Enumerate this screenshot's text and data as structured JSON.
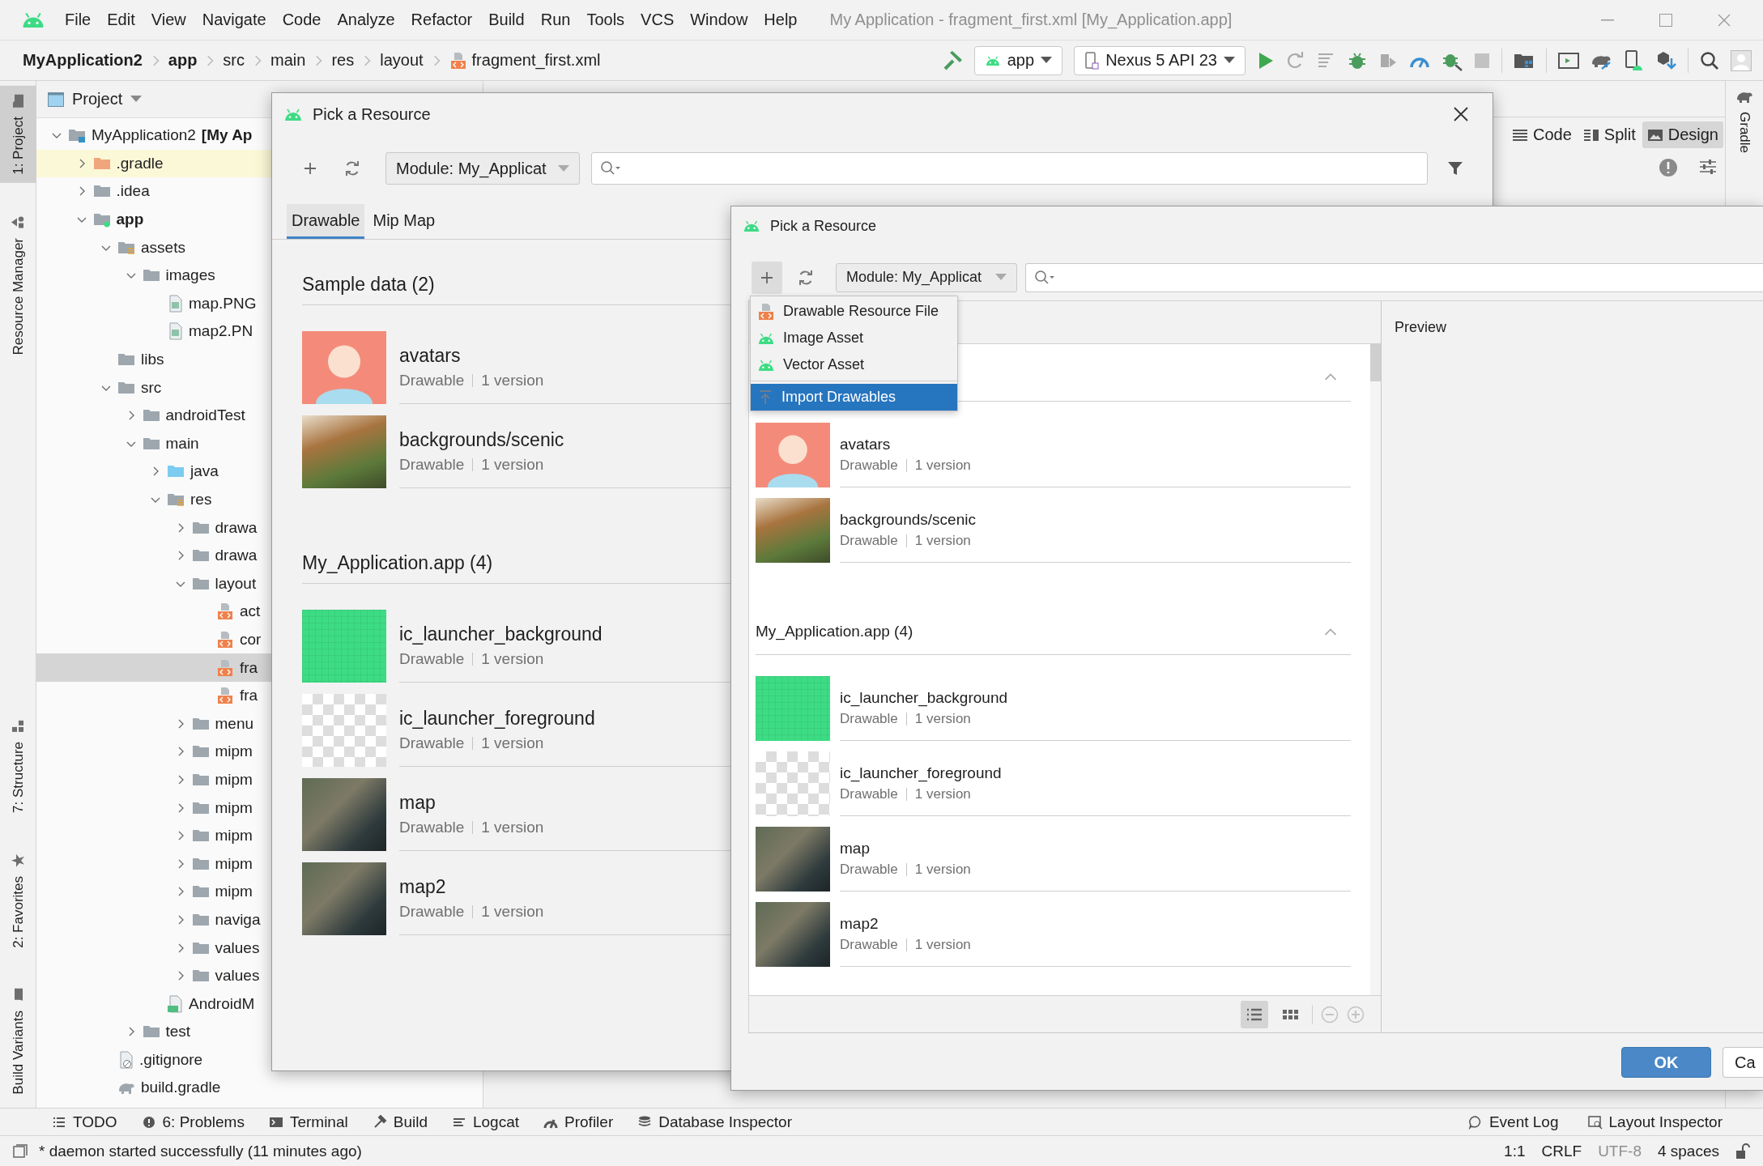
{
  "menu_bar": {
    "items": [
      "File",
      "Edit",
      "View",
      "Navigate",
      "Code",
      "Analyze",
      "Refactor",
      "Build",
      "Run",
      "Tools",
      "VCS",
      "Window",
      "Help"
    ],
    "title": "My Application - fragment_first.xml [My_Application.app]"
  },
  "breadcrumbs": [
    {
      "label": "MyApplication2",
      "kind": "project"
    },
    {
      "label": "app",
      "kind": "module"
    },
    {
      "label": "src",
      "kind": "folder"
    },
    {
      "label": "main",
      "kind": "folder"
    },
    {
      "label": "res",
      "kind": "folder"
    },
    {
      "label": "layout",
      "kind": "folder"
    },
    {
      "label": "fragment_first.xml",
      "kind": "xml_file"
    }
  ],
  "toolbar": {
    "run_config": "app",
    "device": "Nexus 5 API 23"
  },
  "left_strip": {
    "top": [
      {
        "label": "1: Project",
        "kind": "project",
        "selected": true
      },
      {
        "label": "Resource Manager",
        "kind": "resources",
        "selected": false
      }
    ],
    "bottom": [
      {
        "label": "7: Structure",
        "kind": "structure",
        "selected": false
      },
      {
        "label": "2: Favorites",
        "kind": "favorites",
        "selected": false
      },
      {
        "label": "Build Variants",
        "kind": "variants",
        "selected": false
      }
    ]
  },
  "right_strip": [
    {
      "label": "Gradle"
    }
  ],
  "project_panel": {
    "title": "Project",
    "tree": [
      {
        "label": "MyApplication2 **[My Ap**",
        "kind": "project",
        "expanded": true,
        "selected": false,
        "children": [
          {
            "label": ".gradle",
            "kind": "folder_excluded",
            "expanded": false,
            "selected": false
          },
          {
            "label": ".idea",
            "kind": "folder",
            "expanded": false,
            "selected": false
          },
          {
            "label": "app",
            "kind": "module",
            "expanded": true,
            "selected": false,
            "children": [
              {
                "label": "assets",
                "kind": "folder_resources",
                "expanded": true,
                "selected": false,
                "children": [
                  {
                    "label": "images",
                    "kind": "folder",
                    "expanded": true,
                    "selected": false,
                    "children": [
                      {
                        "label": "map.PNG",
                        "kind": "image_file",
                        "selected": false
                      },
                      {
                        "label": "map2.PN",
                        "kind": "image_file",
                        "selected": false
                      }
                    ]
                  }
                ]
              },
              {
                "label": "libs",
                "kind": "folder",
                "selected": false
              },
              {
                "label": "src",
                "kind": "folder",
                "expanded": true,
                "selected": false,
                "children": [
                  {
                    "label": "androidTest",
                    "kind": "folder",
                    "expanded": false,
                    "selected": false
                  },
                  {
                    "label": "main",
                    "kind": "folder",
                    "expanded": true,
                    "selected": false,
                    "children": [
                      {
                        "label": "java",
                        "kind": "folder_source",
                        "expanded": false,
                        "selected": false
                      },
                      {
                        "label": "res",
                        "kind": "folder_resources",
                        "expanded": true,
                        "selected": false,
                        "children": [
                          {
                            "label": "drawa",
                            "kind": "folder",
                            "expanded": false,
                            "selected": false
                          },
                          {
                            "label": "drawa",
                            "kind": "folder",
                            "expanded": false,
                            "selected": false
                          },
                          {
                            "label": "layout",
                            "kind": "folder",
                            "expanded": true,
                            "selected": false,
                            "children": [
                              {
                                "label": "act",
                                "kind": "xml_file",
                                "selected": false
                              },
                              {
                                "label": "cor",
                                "kind": "xml_file",
                                "selected": false
                              },
                              {
                                "label": "fra",
                                "kind": "xml_file",
                                "selected": true
                              },
                              {
                                "label": "fra",
                                "kind": "xml_file",
                                "selected": false
                              }
                            ]
                          },
                          {
                            "label": "menu",
                            "kind": "folder",
                            "expanded": false,
                            "selected": false
                          },
                          {
                            "label": "mipm",
                            "kind": "folder",
                            "expanded": false,
                            "selected": false
                          },
                          {
                            "label": "mipm",
                            "kind": "folder",
                            "expanded": false,
                            "selected": false
                          },
                          {
                            "label": "mipm",
                            "kind": "folder",
                            "expanded": false,
                            "selected": false
                          },
                          {
                            "label": "mipm",
                            "kind": "folder",
                            "expanded": false,
                            "selected": false
                          },
                          {
                            "label": "mipm",
                            "kind": "folder",
                            "expanded": false,
                            "selected": false
                          },
                          {
                            "label": "mipm",
                            "kind": "folder",
                            "expanded": false,
                            "selected": false
                          },
                          {
                            "label": "naviga",
                            "kind": "folder",
                            "expanded": false,
                            "selected": false
                          },
                          {
                            "label": "values",
                            "kind": "folder",
                            "expanded": false,
                            "selected": false
                          },
                          {
                            "label": "values",
                            "kind": "folder",
                            "expanded": false,
                            "selected": false
                          }
                        ]
                      },
                      {
                        "label": "AndroidM",
                        "kind": "manifest",
                        "selected": false
                      }
                    ]
                  },
                  {
                    "label": "test",
                    "kind": "folder",
                    "expanded": false,
                    "selected": false
                  }
                ]
              },
              {
                "label": ".gitignore",
                "kind": "text_file",
                "selected": false
              },
              {
                "label": "build.gradle",
                "kind": "gradle_file",
                "selected": false
              }
            ]
          }
        ]
      }
    ]
  },
  "editor": {
    "view_modes": [
      {
        "label": "Code",
        "kind": "code",
        "selected": false
      },
      {
        "label": "Split",
        "kind": "split",
        "selected": false
      },
      {
        "label": "Design",
        "kind": "design",
        "selected": true
      }
    ]
  },
  "back_dialog": {
    "title": "Pick a Resource",
    "module": "Module: My_Applicat",
    "tabs": [
      {
        "label": "Drawable",
        "selected": true
      },
      {
        "label": "Mip Map",
        "selected": false
      }
    ],
    "sections": [
      {
        "title": "Sample data (2)",
        "items": [
          {
            "name": "avatars",
            "type": "Drawable",
            "versions": "1 version",
            "kind": "avatar"
          },
          {
            "name": "backgrounds/scenic",
            "type": "Drawable",
            "versions": "1 version",
            "kind": "scenic"
          }
        ]
      },
      {
        "title": "My_Application.app (4)",
        "items": [
          {
            "name": "ic_launcher_background",
            "type": "Drawable",
            "versions": "1 version",
            "kind": "green_grid"
          },
          {
            "name": "ic_launcher_foreground",
            "type": "Drawable",
            "versions": "1 version",
            "kind": "transparent"
          },
          {
            "name": "map",
            "type": "Drawable",
            "versions": "1 version",
            "kind": "map"
          },
          {
            "name": "map2",
            "type": "Drawable",
            "versions": "1 version",
            "kind": "map"
          }
        ]
      }
    ]
  },
  "front_dialog": {
    "title": "Pick a Resource",
    "module": "Module: My_Applicat",
    "add_pressed": true,
    "menu": [
      {
        "label": "Drawable Resource File",
        "kind": "xml",
        "selected": false
      },
      {
        "label": "Image Asset",
        "kind": "android",
        "selected": false
      },
      {
        "label": "Vector Asset",
        "kind": "android",
        "selected": false
      },
      {
        "label": "Import Drawables",
        "kind": "import",
        "selected": true
      }
    ],
    "sections": [
      {
        "expanded": true,
        "items": [
          {
            "name": "avatars",
            "type": "Drawable",
            "versions": "1 version",
            "kind": "avatar"
          },
          {
            "name": "backgrounds/scenic",
            "type": "Drawable",
            "versions": "1 version",
            "kind": "scenic"
          }
        ]
      },
      {
        "title": "My_Application.app (4)",
        "expanded": true,
        "items": [
          {
            "name": "ic_launcher_background",
            "type": "Drawable",
            "versions": "1 version",
            "kind": "green_grid"
          },
          {
            "name": "ic_launcher_foreground",
            "type": "Drawable",
            "versions": "1 version",
            "kind": "transparent"
          },
          {
            "name": "map",
            "type": "Drawable",
            "versions": "1 version",
            "kind": "map"
          },
          {
            "name": "map2",
            "type": "Drawable",
            "versions": "1 version",
            "kind": "map"
          }
        ]
      }
    ],
    "view_modes": [
      {
        "kind": "list",
        "selected": true
      },
      {
        "kind": "grid",
        "selected": false
      }
    ],
    "preview_label": "Preview",
    "buttons": [
      {
        "label": "OK",
        "kind": "primary"
      },
      {
        "label": "Ca",
        "kind": "default"
      }
    ]
  },
  "tool_windows": {
    "left": [
      {
        "label": "TODO",
        "kind": "list"
      },
      {
        "label": "6: Problems",
        "kind": "problems"
      },
      {
        "label": "Terminal",
        "kind": "terminal"
      },
      {
        "label": "Build",
        "kind": "build"
      },
      {
        "label": "Logcat",
        "kind": "logcat"
      },
      {
        "label": "Profiler",
        "kind": "profiler"
      },
      {
        "label": "Database Inspector",
        "kind": "database"
      }
    ],
    "right": [
      {
        "label": "Event Log",
        "kind": "event"
      },
      {
        "label": "Layout Inspector",
        "kind": "inspector"
      }
    ]
  },
  "status_bar": {
    "message": "* daemon started successfully (11 minutes ago)",
    "items": [
      {
        "label": "1:1",
        "disabled": false
      },
      {
        "label": "CRLF",
        "disabled": false
      },
      {
        "label": "UTF-8",
        "disabled": true
      },
      {
        "label": "4 spaces",
        "disabled": false
      }
    ]
  }
}
